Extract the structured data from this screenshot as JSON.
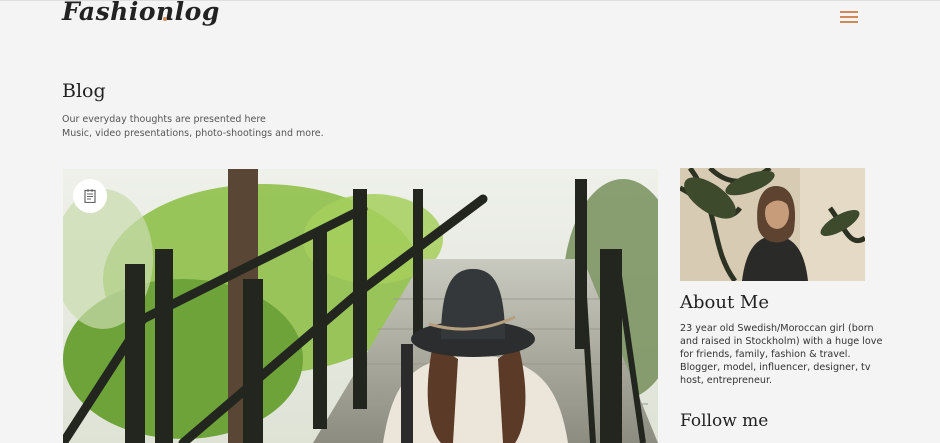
{
  "brand": {
    "name": "Fashionlog",
    "accent": "#d08a5a"
  },
  "header": {
    "menu_icon": "hamburger-icon"
  },
  "page": {
    "title": "Blog",
    "description_lines": [
      "Our everyday thoughts are presented here",
      "Music, video presentations, photo-shootings and more."
    ]
  },
  "post": {
    "type_icon": "document-icon"
  },
  "sidebar": {
    "about_title": "About Me",
    "about_lines": [
      "23 year old Swedish/Moroccan girl (born",
      "and raised in Stockholm) with a huge love",
      "for friends, family, fashion & travel.",
      "Blogger, model, influencer, designer, tv",
      "host, entrepreneur."
    ],
    "follow_title": "Follow me"
  }
}
